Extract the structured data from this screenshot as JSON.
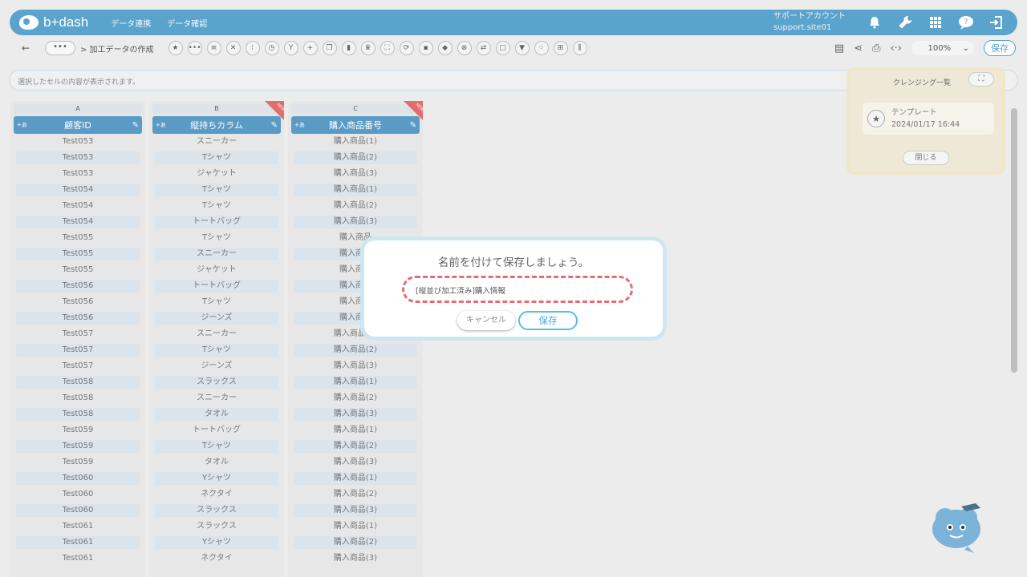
{
  "header": {
    "logo": "b+dash",
    "nav": [
      "データ連携",
      "データ確認"
    ],
    "account_label": "サポートアカウント",
    "account_id": "support.site01"
  },
  "toolbar": {
    "back": "←",
    "more": "•••",
    "breadcrumb": "> 加工データの作成",
    "tool_icons": [
      "star-icon",
      "more-icon",
      "list-icon",
      "tools-icon",
      "grid-icon",
      "timer-icon",
      "branch-icon",
      "plus-icon",
      "copy-icon",
      "trash-icon",
      "crown-icon",
      "expand-icon",
      "refresh-icon",
      "lock-icon",
      "box-icon",
      "close-circle-icon",
      "shuffle-icon",
      "square-icon",
      "filter-icon",
      "dots-grid-icon",
      "table-icon",
      "columns-icon"
    ],
    "zoom": "100%",
    "save": "保存"
  },
  "cell_bar": {
    "placeholder": "選択したセルの内容が表示されます。"
  },
  "columns": [
    {
      "letter": "A",
      "name": "顧客ID",
      "tag": "+あ",
      "is_new": false,
      "cells": [
        "Test053",
        "Test053",
        "Test053",
        "Test054",
        "Test054",
        "Test054",
        "Test055",
        "Test055",
        "Test055",
        "Test056",
        "Test056",
        "Test056",
        "Test057",
        "Test057",
        "Test057",
        "Test058",
        "Test058",
        "Test058",
        "Test059",
        "Test059",
        "Test059",
        "Test060",
        "Test060",
        "Test060",
        "Test061",
        "Test061",
        "Test061"
      ]
    },
    {
      "letter": "B",
      "name": "縦持ちカラム",
      "tag": "+あ",
      "is_new": true,
      "cells": [
        "スニーカー",
        "Tシャツ",
        "ジャケット",
        "Tシャツ",
        "Tシャツ",
        "トートバッグ",
        "Tシャツ",
        "スニーカー",
        "ジャケット",
        "トートバッグ",
        "Tシャツ",
        "ジーンズ",
        "スニーカー",
        "Tシャツ",
        "ジーンズ",
        "スラックス",
        "スニーカー",
        "タオル",
        "トートバッグ",
        "Tシャツ",
        "タオル",
        "Yシャツ",
        "ネクタイ",
        "スラックス",
        "スラックス",
        "Yシャツ",
        "ネクタイ"
      ]
    },
    {
      "letter": "C",
      "name": "購入商品番号",
      "tag": "+あ",
      "is_new": true,
      "cells": [
        "購入商品(1)",
        "購入商品(2)",
        "購入商品(3)",
        "購入商品(1)",
        "購入商品(2)",
        "購入商品(3)",
        "購入商品",
        "購入商品",
        "購入商品",
        "購入商品",
        "購入商品",
        "購入商品",
        "購入商品(1)",
        "購入商品(2)",
        "購入商品(3)",
        "購入商品(1)",
        "購入商品(2)",
        "購入商品(3)",
        "購入商品(1)",
        "購入商品(2)",
        "購入商品(3)",
        "購入商品(1)",
        "購入商品(2)",
        "購入商品(3)",
        "購入商品(1)",
        "購入商品(2)",
        "購入商品(3)"
      ]
    }
  ],
  "new_badge": "NEW",
  "side_panel": {
    "title": "クレンジング一覧",
    "template_name": "テンプレート",
    "template_date": "2024/01/17 16:44",
    "close": "閉じる"
  },
  "modal": {
    "title": "名前を付けて保存しましょう。",
    "name_value": "[縦並び加工済み]購入情報",
    "cancel": "キャンセル",
    "save": "保存"
  }
}
